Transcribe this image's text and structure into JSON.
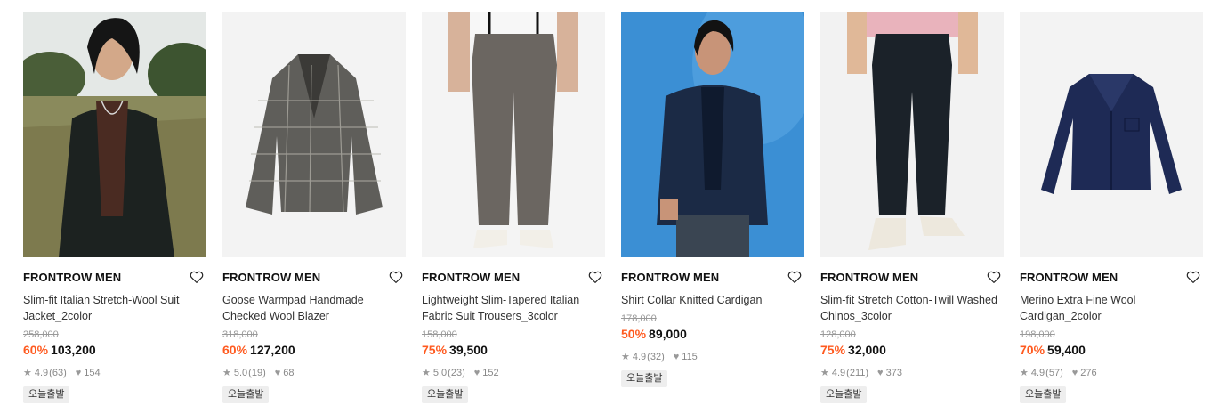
{
  "products": [
    {
      "brand": "FRONTROW MEN",
      "name": "Slim-fit Italian Stretch-Wool Suit Jacket_2color",
      "original_price": "258,000",
      "discount": "60%",
      "price": "103,200",
      "rating": "4.9",
      "reviews": "(63)",
      "likes": "154",
      "badge": "오늘출발",
      "image": "model in black suit jacket outdoors"
    },
    {
      "brand": "FRONTROW MEN",
      "name": "Goose Warmpad Handmade Checked Wool Blazer",
      "original_price": "318,000",
      "discount": "60%",
      "price": "127,200",
      "rating": "5.0",
      "reviews": "(19)",
      "likes": "68",
      "badge": "오늘출발",
      "image": "checked grey wool blazer"
    },
    {
      "brand": "FRONTROW MEN",
      "name": "Lightweight Slim-Tapered Italian Fabric Suit Trousers_3color",
      "original_price": "158,000",
      "discount": "75%",
      "price": "39,500",
      "rating": "5.0",
      "reviews": "(23)",
      "likes": "152",
      "badge": "오늘출발",
      "image": "brown suit trousers with suspenders"
    },
    {
      "brand": "FRONTROW MEN",
      "name": "Shirt Collar Knitted Cardigan",
      "original_price": "178,000",
      "discount": "50%",
      "price": "89,000",
      "rating": "4.9",
      "reviews": "(32)",
      "likes": "115",
      "badge": "오늘출발",
      "image": "model in navy knit cardigan on blue background"
    },
    {
      "brand": "FRONTROW MEN",
      "name": "Slim-fit Stretch Cotton-Twill Washed Chinos_3color",
      "original_price": "128,000",
      "discount": "75%",
      "price": "32,000",
      "rating": "4.9",
      "reviews": "(211)",
      "likes": "373",
      "badge": "오늘출발",
      "image": "navy chinos with white sneakers"
    },
    {
      "brand": "FRONTROW MEN",
      "name": "Merino Extra Fine Wool Cardigan_2color",
      "original_price": "198,000",
      "discount": "70%",
      "price": "59,400",
      "rating": "4.9",
      "reviews": "(57)",
      "likes": "276",
      "badge": "오늘출발",
      "image": "navy merino wool cardigan flat lay"
    }
  ],
  "colors": {
    "discount": "#ff5a1f",
    "badge_bg": "#eeeeee",
    "muted": "#888888"
  },
  "icons": {
    "wishlist": "heart-outline-icon",
    "rating": "star-icon",
    "likes": "heart-filled-icon"
  }
}
